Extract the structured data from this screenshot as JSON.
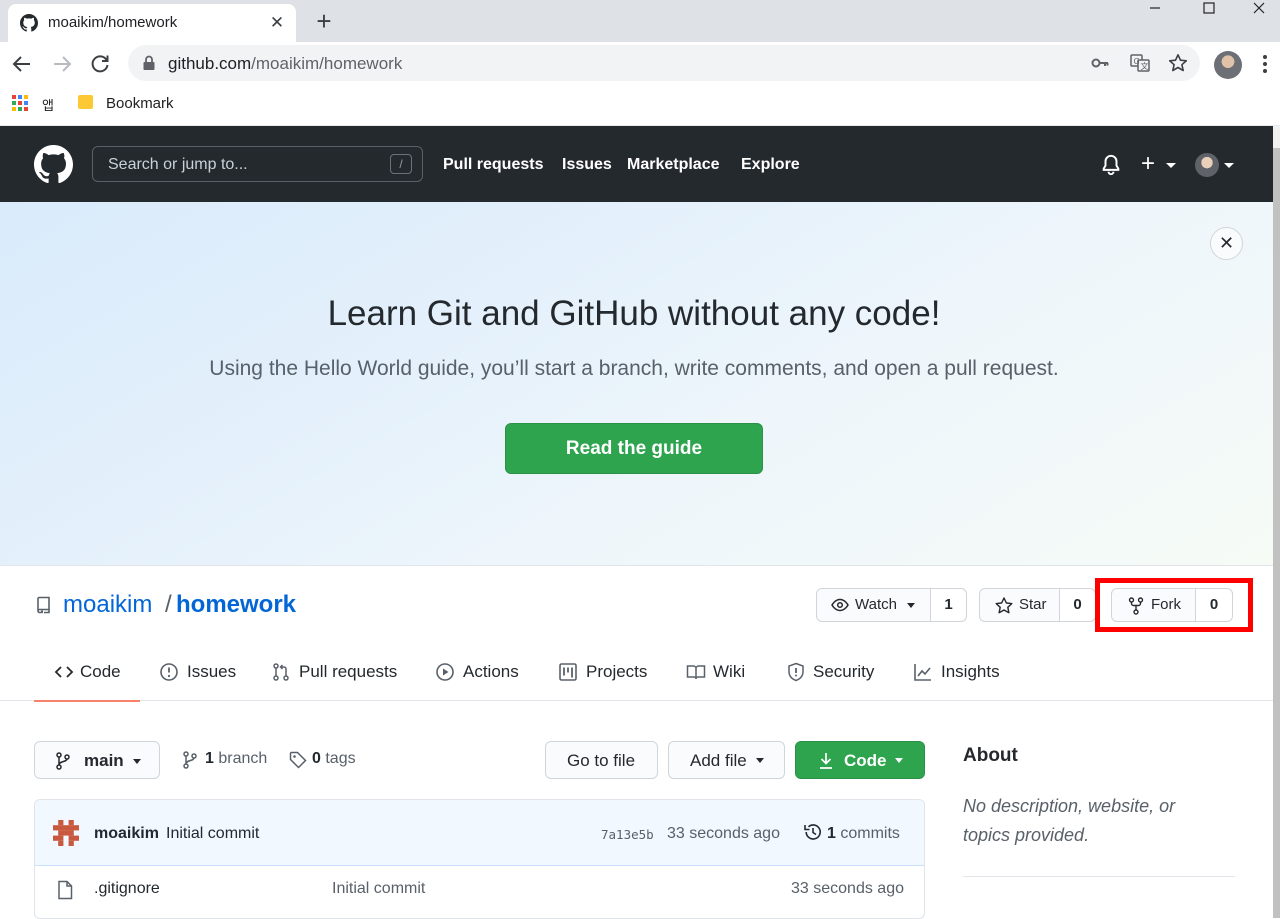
{
  "browser": {
    "tab_title": "moaikim/homework",
    "tab_close": "✕",
    "new_tab": "+",
    "url_host": "github.com",
    "url_path": "/moaikim/homework",
    "bookmarks": {
      "apps_label": "앱",
      "folder_label": "Bookmark"
    }
  },
  "github_header": {
    "search_placeholder": "Search or jump to...",
    "search_shortcut": "/",
    "nav": [
      "Pull requests",
      "Issues",
      "Marketplace",
      "Explore"
    ],
    "create_label": "+"
  },
  "banner": {
    "close": "✕",
    "title": "Learn Git and GitHub without any code!",
    "subtitle": "Using the Hello World guide, you’ll start a branch, write comments, and open a pull request.",
    "button": "Read the guide"
  },
  "repo": {
    "owner": "moaikim",
    "separator": "/",
    "name": "homework",
    "watch": {
      "label": "Watch",
      "count": "1"
    },
    "star": {
      "label": "Star",
      "count": "0"
    },
    "fork": {
      "label": "Fork",
      "count": "0"
    }
  },
  "tabs": [
    {
      "label": "Code",
      "icon": "code-icon",
      "active": true
    },
    {
      "label": "Issues",
      "icon": "issue-opened-icon"
    },
    {
      "label": "Pull requests",
      "icon": "git-pull-request-icon"
    },
    {
      "label": "Actions",
      "icon": "play-icon"
    },
    {
      "label": "Projects",
      "icon": "project-icon"
    },
    {
      "label": "Wiki",
      "icon": "book-icon"
    },
    {
      "label": "Security",
      "icon": "shield-icon"
    },
    {
      "label": "Insights",
      "icon": "graph-icon"
    }
  ],
  "toolbar": {
    "branch": "main",
    "branches_count": "1",
    "branches_label": "branch",
    "tags_count": "0",
    "tags_label": "tags",
    "go_to_file": "Go to file",
    "add_file": "Add file",
    "code": "Code"
  },
  "commit": {
    "author": "moaikim",
    "message": "Initial commit",
    "sha": "7a13e5b",
    "time": "33 seconds ago",
    "count": "1",
    "count_label": "commits"
  },
  "files": [
    {
      "name": ".gitignore",
      "message": "Initial commit",
      "time": "33 seconds ago"
    }
  ],
  "about": {
    "title": "About",
    "description": "No description, website, or topics provided."
  },
  "colors": {
    "github_header": "#24292e",
    "primary_green": "#2ea44f",
    "link_blue": "#0366d6",
    "highlight_red": "#ff0000",
    "active_tab_underline": "#f9826c"
  }
}
